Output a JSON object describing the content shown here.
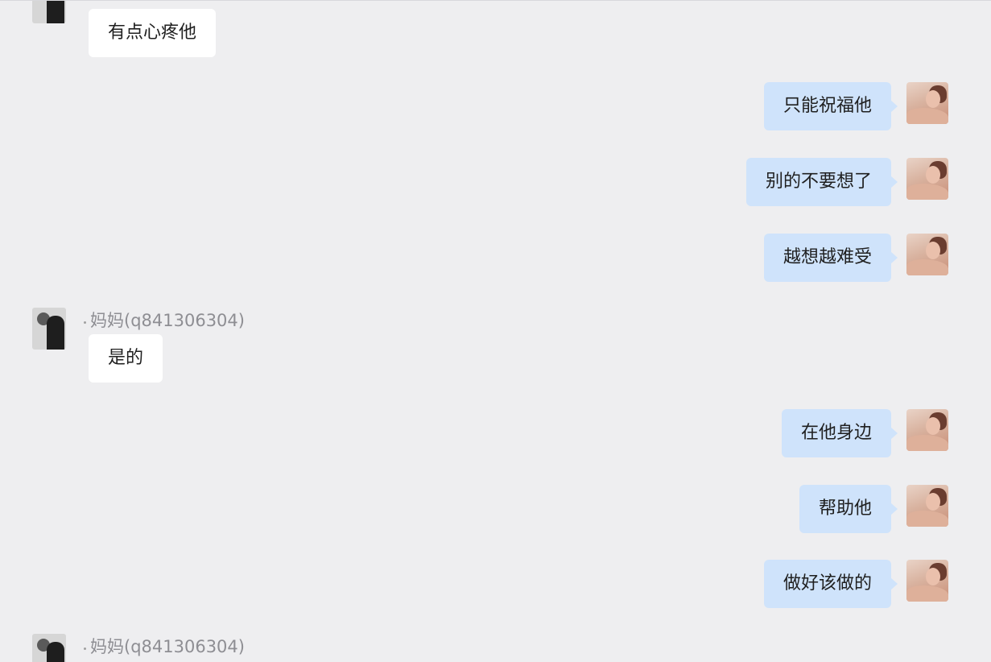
{
  "conversation": {
    "top_message": "有点心疼他",
    "self_messages_group1": [
      "只能祝福他",
      "别的不要想了",
      "越想越难受"
    ],
    "mom_message_1": {
      "sender": "妈妈(q841306304)",
      "text": "是的"
    },
    "self_messages_group2": [
      "在他身边",
      "帮助他",
      "做好该做的"
    ],
    "mom_message_2": {
      "sender": "妈妈(q841306304)"
    }
  },
  "icons": {
    "self_avatar": "user-avatar-icon",
    "mom_avatar": "contact-avatar-icon"
  },
  "colors": {
    "background": "#eeeef0",
    "incoming_bubble": "#ffffff",
    "outgoing_bubble": "#cfe3fb",
    "sender_name": "#8e8e93"
  }
}
